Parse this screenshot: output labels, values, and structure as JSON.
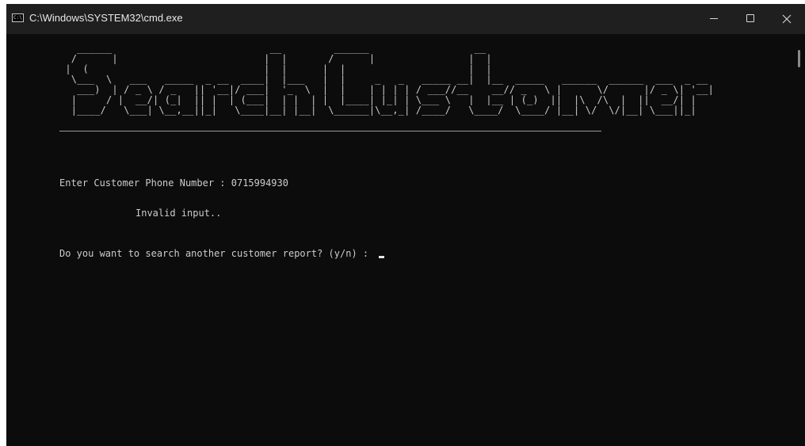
{
  "window": {
    "title": "C:\\Windows\\SYSTEM32\\cmd.exe",
    "icon": "cmd-icon",
    "icon_text": "C:\\."
  },
  "controls": {
    "minimize": "minimize-icon",
    "maximize": "maximize-icon",
    "close": "close-icon"
  },
  "console": {
    "banner": "   ______                           __         ______                  __                                      \n  /      |                         |  |       /      |                |  |                                     \n |  (                              |  |      |  |                     |  |                                      \n  \\___  \\   ___   _____  _ __  ____|  |___   |  |     _   _   _____ __|  |__  _____   ______  ______  ___  _ __ \n   ___)  | / _ \\ / _   || '__|/ ___|  '_  \\  |  |    | | | | / ___//__    __// _   \\ |      \\/      |/ _ \\| '__|\n  |     / |  __/| (_|  || |  | (___|  | |  | |  |____| |_| | \\___ \\   |  |__ | (_)  ||  |\\  /\\  |  ||  __/| |   \n  |____/   \\___| \\__,__||_|   \\____|__| |__|  \\______|\\__,_| /____/   \\____/  \\____/ |__| \\/  \\/|__| \\___||_|   ",
    "phone_prompt": "Enter Customer Phone Number : 0715994930",
    "error_message": "Invalid input..",
    "again_prompt": "Do you want to search another customer report? (y/n) : "
  }
}
